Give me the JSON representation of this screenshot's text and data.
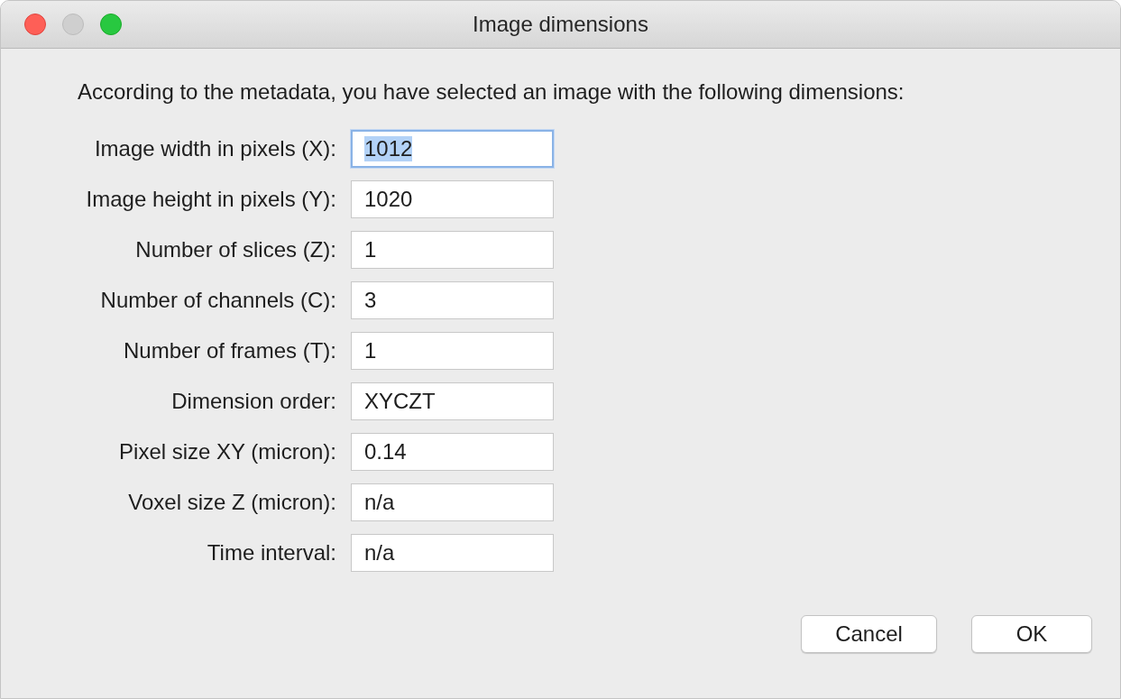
{
  "window": {
    "title": "Image dimensions"
  },
  "intro": "According to the metadata, you have selected an image with the following dimensions:",
  "fields": [
    {
      "label": "Image width in pixels (X):",
      "value": "1012",
      "focused": true
    },
    {
      "label": "Image height in pixels (Y):",
      "value": "1020",
      "focused": false
    },
    {
      "label": "Number of slices (Z):",
      "value": "1",
      "focused": false
    },
    {
      "label": "Number of channels (C):",
      "value": "3",
      "focused": false
    },
    {
      "label": "Number of frames (T):",
      "value": "1",
      "focused": false
    },
    {
      "label": "Dimension order:",
      "value": "XYCZT",
      "focused": false
    },
    {
      "label": "Pixel size XY (micron):",
      "value": "0.14",
      "focused": false
    },
    {
      "label": "Voxel size Z (micron):",
      "value": "n/a",
      "focused": false
    },
    {
      "label": "Time interval:",
      "value": "n/a",
      "focused": false
    }
  ],
  "buttons": [
    {
      "label": "Cancel"
    },
    {
      "label": "OK"
    }
  ]
}
